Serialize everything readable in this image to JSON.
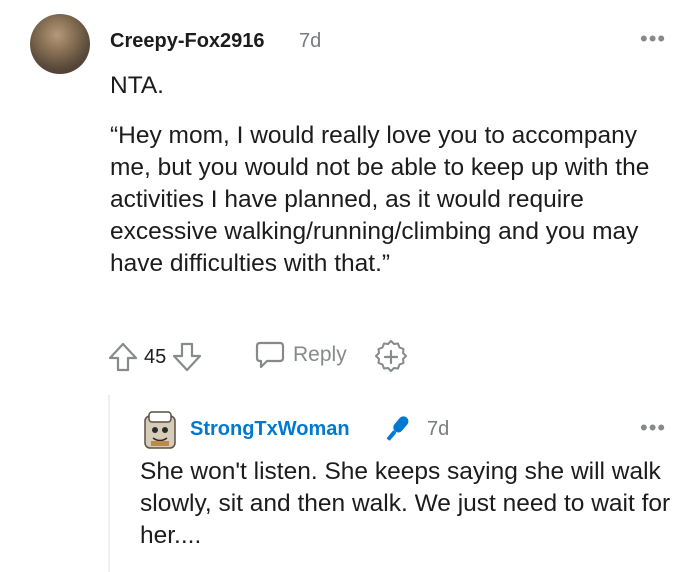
{
  "comment": {
    "author": "Creepy-Fox2916",
    "age": "7d",
    "more_icon": "more-dots-icon",
    "body_line1": "NTA.",
    "body_quote": "“Hey mom, I would really love you to accompany me, but you would not be able to keep up with the activities I have planned, as it would require excessive walking/running/climbing and you may have difficulties with that.”",
    "upvote_icon": "arrow-up-icon",
    "score": "45",
    "downvote_icon": "arrow-down-icon",
    "reply_icon": "chat-bubble-icon",
    "reply_label": "Reply",
    "award_icon": "award-plus-icon"
  },
  "reply": {
    "author": "StrongTxWoman",
    "author_color": "#0079d3",
    "badge_icon": "microphone-icon",
    "age": "7d",
    "more_icon": "more-dots-icon",
    "body": "She won't listen. She keeps saying she will walk slowly, sit and then walk. We just need to wait for her...."
  }
}
